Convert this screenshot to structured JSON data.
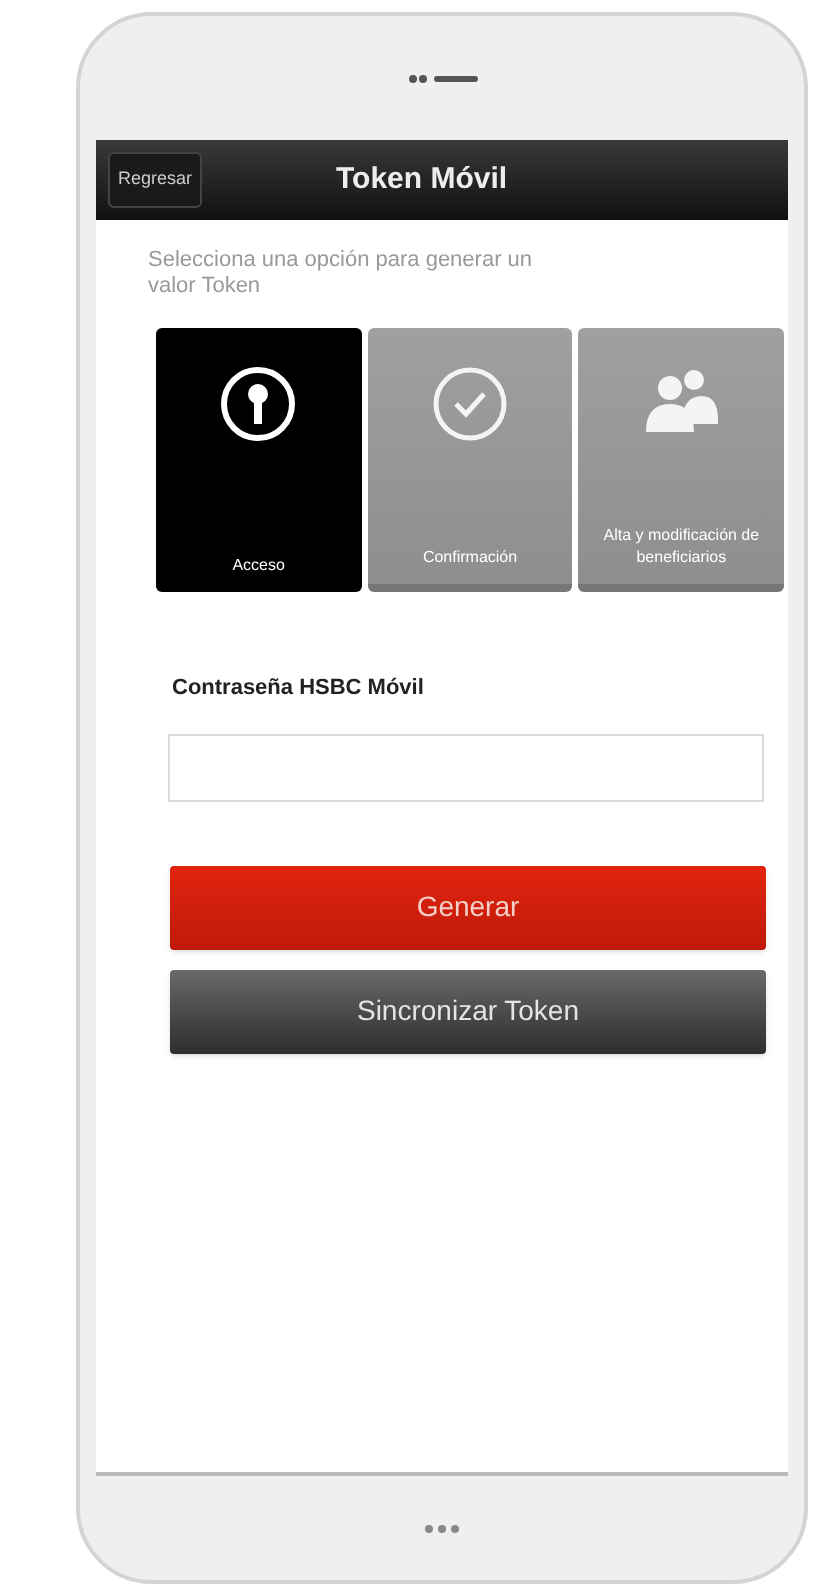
{
  "header": {
    "back_button": "Regresar",
    "title": "Token Móvil"
  },
  "instruction": "Selecciona una opción para generar un valor Token",
  "options": [
    {
      "kind": "key",
      "label": "Acceso",
      "selected": true
    },
    {
      "kind": "check",
      "label": "Confirmación",
      "selected": false
    },
    {
      "kind": "people",
      "label": "Alta y modificación de beneficiarios",
      "selected": false
    }
  ],
  "password": {
    "label": "Contraseña HSBC Móvil"
  },
  "buttons": [
    {
      "kind": "primary",
      "label": "Generar"
    },
    {
      "kind": "secondary",
      "label": "Sincronizar Token"
    }
  ]
}
